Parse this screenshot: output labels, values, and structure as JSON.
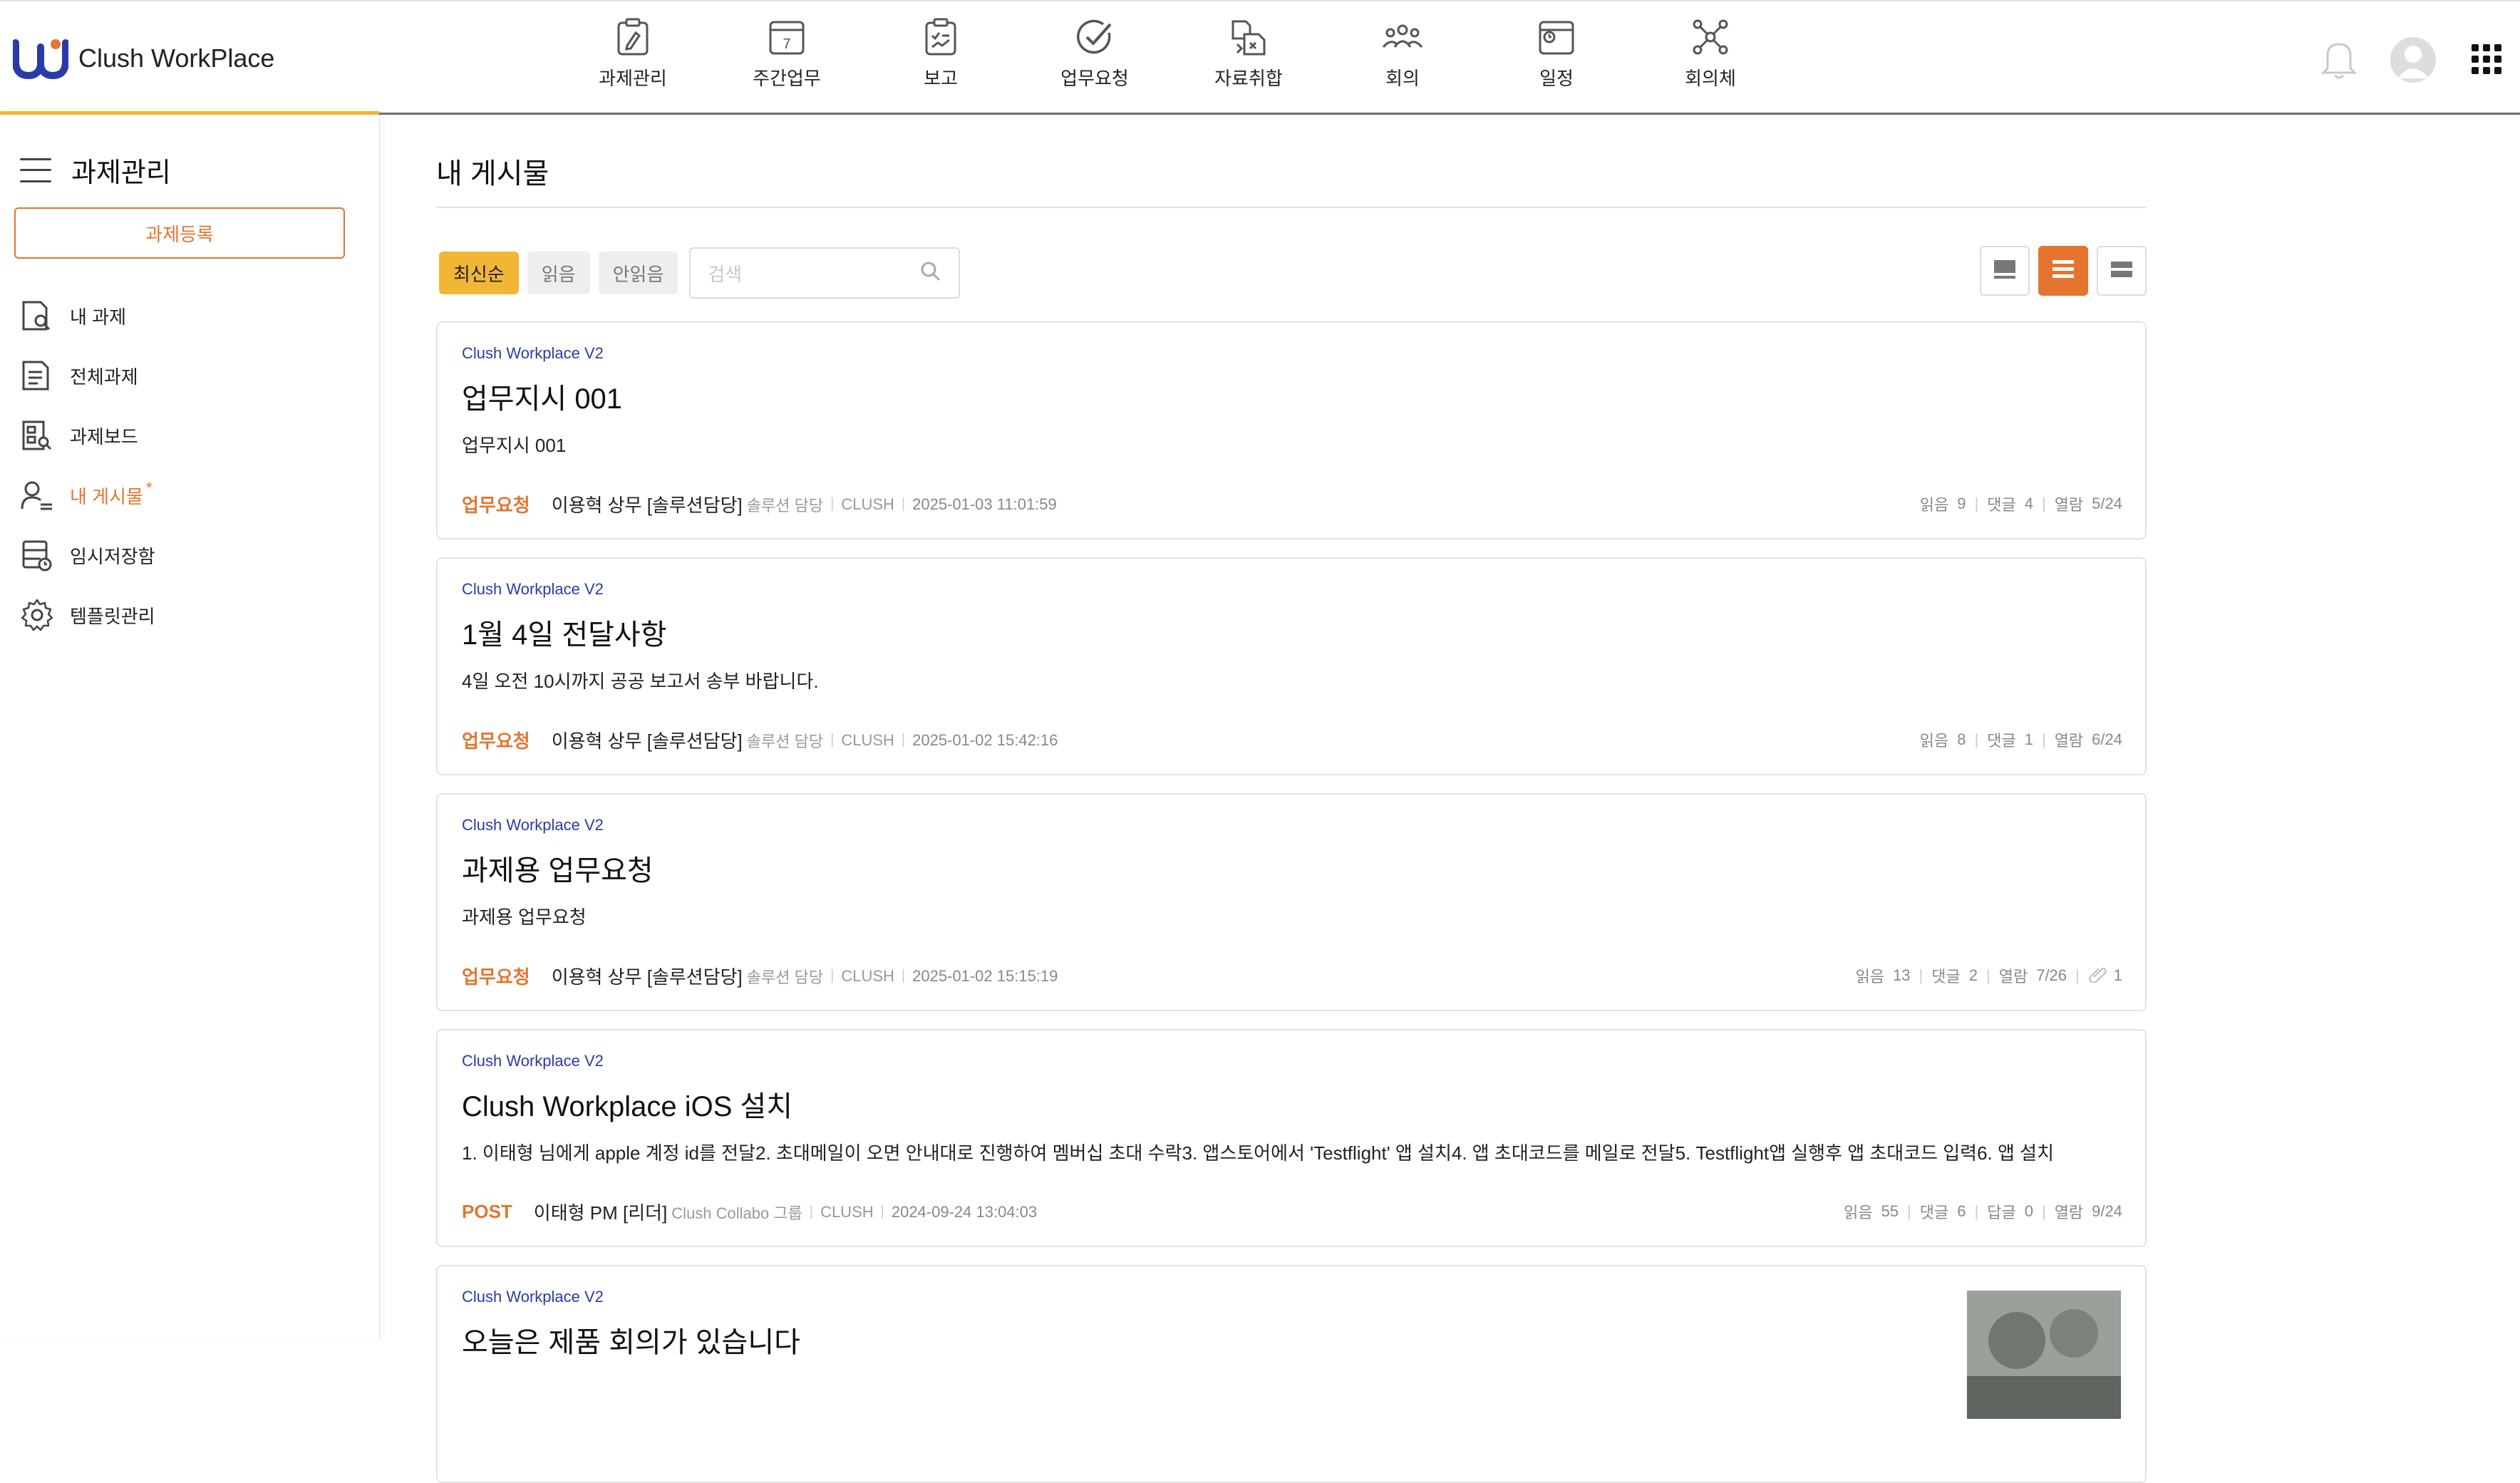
{
  "app": {
    "name": "Clush WorkPlace"
  },
  "nav": [
    {
      "label": "과제관리",
      "icon": "task-edit-icon"
    },
    {
      "label": "주간업무",
      "icon": "calendar-icon"
    },
    {
      "label": "보고",
      "icon": "report-icon"
    },
    {
      "label": "업무요청",
      "icon": "check-circle-icon"
    },
    {
      "label": "자료취합",
      "icon": "file-merge-icon"
    },
    {
      "label": "회의",
      "icon": "people-icon"
    },
    {
      "label": "일정",
      "icon": "schedule-icon"
    },
    {
      "label": "회의체",
      "icon": "network-icon"
    }
  ],
  "calendar_day": "7",
  "sidebar": {
    "title": "과제관리",
    "register_button": "과제등록",
    "items": [
      {
        "label": "내 과제",
        "icon": "my-task-icon"
      },
      {
        "label": "전체과제",
        "icon": "all-tasks-icon"
      },
      {
        "label": "과제보드",
        "icon": "task-board-icon"
      },
      {
        "label": "내 게시물",
        "icon": "my-posts-icon",
        "active": true,
        "marker": "*"
      },
      {
        "label": "임시저장함",
        "icon": "draft-box-icon"
      },
      {
        "label": "템플릿관리",
        "icon": "settings-gear-icon"
      }
    ]
  },
  "main": {
    "title": "내 게시물",
    "filters": [
      "최신순",
      "읽음",
      "안읽음"
    ],
    "search_placeholder": "검색",
    "posts": [
      {
        "project": "Clush Workplace V2",
        "title": "업무지시 001",
        "body": "업무지시 001",
        "tag": "업무요청",
        "author": "이용혁 상무 [솔루션담당]",
        "dept": "솔루션 담당",
        "org": "CLUSH",
        "date": "2025-01-03 11:01:59",
        "read_label": "읽음",
        "read": "9",
        "comment_label": "댓글",
        "comments": "4",
        "view_label": "열람",
        "views": "5/24"
      },
      {
        "project": "Clush Workplace V2",
        "title": "1월 4일 전달사항",
        "body": "4일 오전 10시까지 공공 보고서 송부 바랍니다.",
        "tag": "업무요청",
        "author": "이용혁 상무 [솔루션담당]",
        "dept": "솔루션 담당",
        "org": "CLUSH",
        "date": "2025-01-02 15:42:16",
        "read_label": "읽음",
        "read": "8",
        "comment_label": "댓글",
        "comments": "1",
        "view_label": "열람",
        "views": "6/24"
      },
      {
        "project": "Clush Workplace V2",
        "title": "과제용 업무요청",
        "body": "과제용 업무요청",
        "tag": "업무요청",
        "author": "이용혁 상무 [솔루션담당]",
        "dept": "솔루션 담당",
        "org": "CLUSH",
        "date": "2025-01-02 15:15:19",
        "read_label": "읽음",
        "read": "13",
        "comment_label": "댓글",
        "comments": "2",
        "view_label": "열람",
        "views": "7/26",
        "attachments": "1"
      },
      {
        "project": "Clush Workplace V2",
        "title": "Clush Workplace iOS 설치",
        "body": "1. 이태형 님에게 apple 계정 id를 전달2. 초대메일이 오면 안내대로 진행하여 멤버십 초대 수락3. 앱스토어에서 'Testflight' 앱 설치4. 앱 초대코드를 메일로 전달5. Testflight앱 실행후 앱 초대코드 입력6. 앱 설치",
        "tag": "POST",
        "author": "이태형 PM [리더]",
        "dept": "Clush Collabo 그룹",
        "org": "CLUSH",
        "date": "2024-09-24 13:04:03",
        "read_label": "읽음",
        "read": "55",
        "comment_label": "댓글",
        "comments": "6",
        "reply_label": "답글",
        "replies": "0",
        "view_label": "열람",
        "views": "9/24"
      },
      {
        "project": "Clush Workplace V2",
        "title": "오늘은 제품 회의가 있습니다"
      }
    ]
  },
  "colors": {
    "accent": "#e5742f",
    "highlight": "#f2b637",
    "project_link": "#2a3aa8"
  }
}
